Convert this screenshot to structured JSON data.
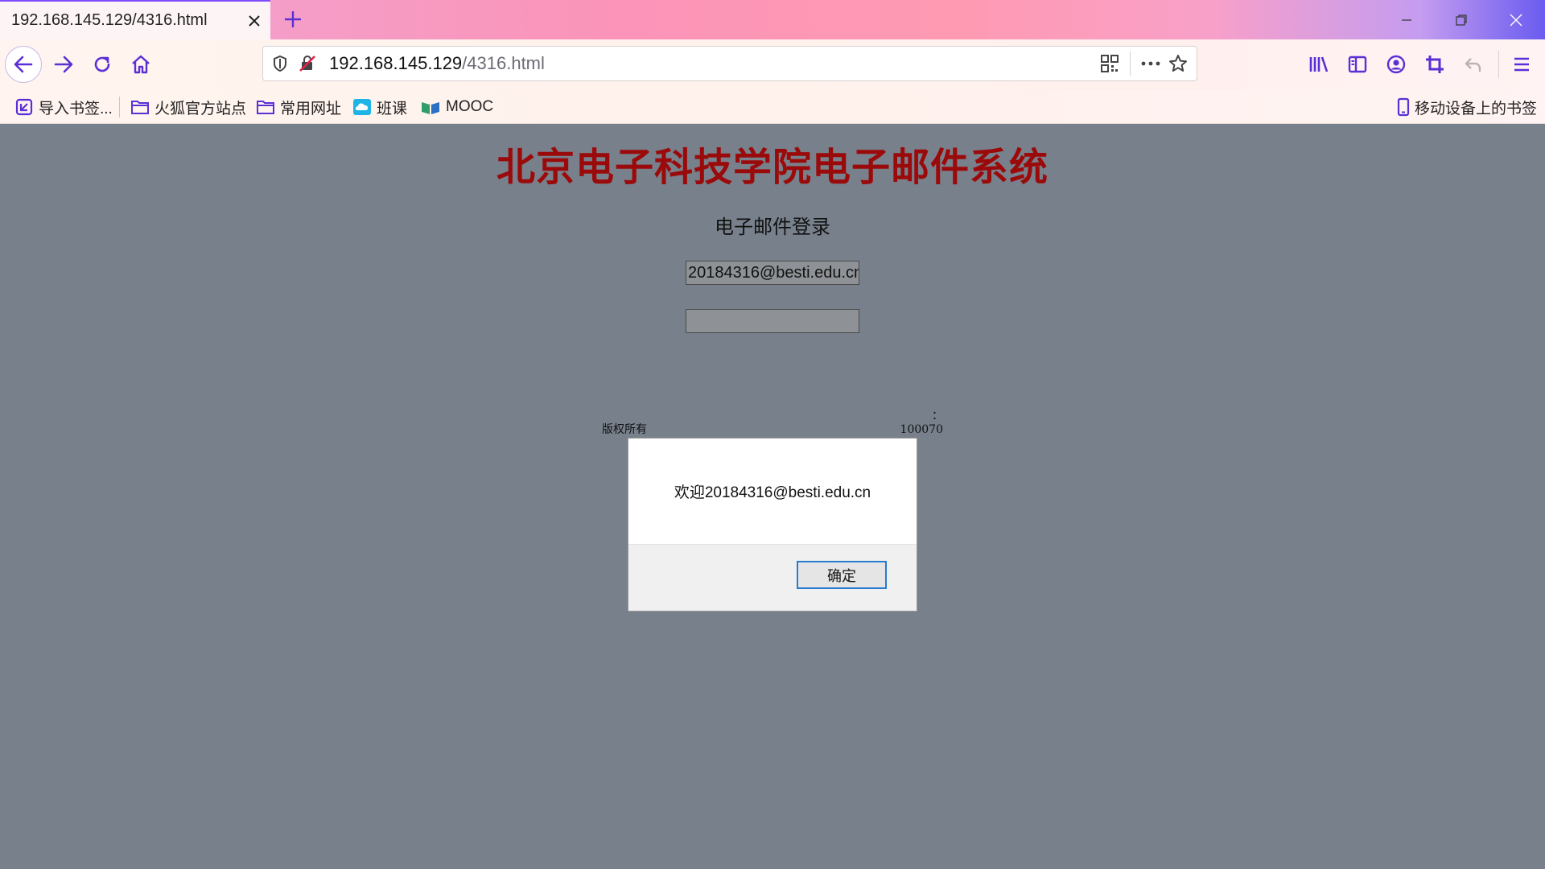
{
  "browser": {
    "tab_title": "192.168.145.129/4316.html",
    "url_host": "192.168.145.129",
    "url_path": "/4316.html",
    "accent_color": "#7f4cff"
  },
  "bookmarks": [
    {
      "label": "导入书签...",
      "icon": "import-icon"
    },
    {
      "label": "火狐官方站点",
      "icon": "folder-icon"
    },
    {
      "label": "常用网址",
      "icon": "folder-icon"
    },
    {
      "label": "班课",
      "icon": "cloud-class-icon"
    },
    {
      "label": "MOOC",
      "icon": "book-icon"
    }
  ],
  "mobile_bookmarks": "移动设备上的书签",
  "page": {
    "heading": "北京电子科技学院电子邮件系统",
    "heading_color": "#9b0a0a",
    "subheading": "电子邮件登录",
    "email_value": "20184316@besti.edu.cn",
    "copyright_left": "版权所有",
    "copyright_right": "：100070"
  },
  "dialog": {
    "message": "欢迎20184316@besti.edu.cn",
    "ok_label": "确定"
  }
}
